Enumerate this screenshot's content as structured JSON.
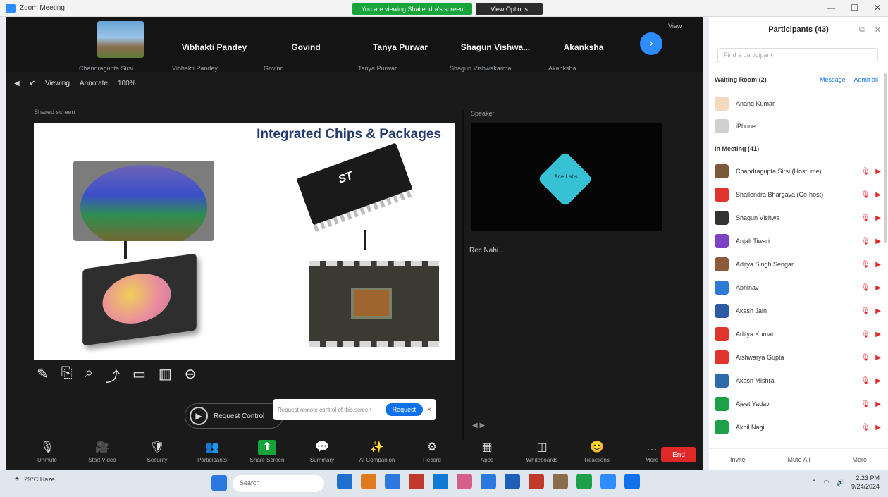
{
  "window": {
    "title": "Zoom Meeting",
    "share_banner": "You are viewing Shailendra's screen",
    "stop_button": "View Options"
  },
  "strip": {
    "participants": [
      {
        "name": "",
        "sub": "Chandragupta Sirsi"
      },
      {
        "name": "Vibhakti Pandey",
        "sub": "Vibhakti Pandey"
      },
      {
        "name": "Govind",
        "sub": "Govind"
      },
      {
        "name": "Tanya Purwar",
        "sub": "Tanya Purwar"
      },
      {
        "name": "Shagun Vishwa...",
        "sub": "Shagun Vishwakarma"
      },
      {
        "name": "Akanksha",
        "sub": "Akanksha"
      }
    ],
    "view_label": "View"
  },
  "subbar": {
    "viewing": "Viewing",
    "annotate": "Annotate",
    "zoom": "100%"
  },
  "slide": {
    "title": "Integrated Chips & Packages",
    "chip_logo": "ST"
  },
  "share_labels": {
    "left": "Shared screen",
    "right": "Speaker"
  },
  "speaker_tile": {
    "brand": "Ace Labs"
  },
  "chat": {
    "line": "Rec Nahi..."
  },
  "toolbar": {
    "items": [
      {
        "icon": "🎙",
        "label": "Unmute"
      },
      {
        "icon": "🎥",
        "label": "Start Video"
      },
      {
        "icon": "🛡",
        "label": "Security"
      },
      {
        "icon": "👥",
        "label": "Participants"
      },
      {
        "icon": "⬆",
        "label": "Share Screen"
      },
      {
        "icon": "💬",
        "label": "Summary"
      },
      {
        "icon": "✨",
        "label": "AI Companion"
      },
      {
        "icon": "⚙",
        "label": "Record"
      },
      {
        "icon": "▦",
        "label": "Apps"
      },
      {
        "icon": "◫",
        "label": "Whiteboards"
      },
      {
        "icon": "😊",
        "label": "Reactions"
      },
      {
        "icon": "…",
        "label": "More"
      }
    ],
    "end": "End"
  },
  "annotation": {
    "control_text": "Request Control",
    "popup_text": "Request remote control of this screen",
    "popup_button": "Request",
    "popup_close": "×"
  },
  "panel": {
    "title": "Participants (43)",
    "search_placeholder": "Find a participant",
    "waiting": "Waiting Room (2)",
    "message": "Message",
    "admit_all": "Admit all",
    "waiting_people": [
      {
        "name": "Anand Kumar",
        "color": "#f3d9bf"
      },
      {
        "name": "iPhone",
        "color": "#cfcfcf"
      }
    ],
    "in_meeting": "In Meeting (41)",
    "people": [
      {
        "name": "Chandragupta Sirsi (Host, me)",
        "color": "#7a5a3a"
      },
      {
        "name": "Shailendra Bhargava (Co-host)",
        "color": "#e0342c"
      },
      {
        "name": "Shagun Vishwa",
        "color": "#333333"
      },
      {
        "name": "Anjali Tiwari",
        "color": "#7b42c4"
      },
      {
        "name": "Aditya Singh Sengar",
        "color": "#8a5a3a"
      },
      {
        "name": "Abhinav",
        "color": "#2e7bd6"
      },
      {
        "name": "Akash Jain",
        "color": "#2e5aa6"
      },
      {
        "name": "Aditya Kumar",
        "color": "#e0342c"
      },
      {
        "name": "Aishwarya Gupta",
        "color": "#e0342c"
      },
      {
        "name": "Akash Mishra",
        "color": "#2e6aa6"
      },
      {
        "name": "Ajeet Yadav",
        "color": "#1ea04a"
      },
      {
        "name": "Akhil Nagi",
        "color": "#1ea04a"
      }
    ],
    "footer": [
      "Invite",
      "Mute All",
      "More"
    ]
  },
  "taskbar": {
    "weather": "29°C Haze",
    "search": "Search",
    "time": "2:23 PM",
    "date": "9/24/2024",
    "apps": [
      "#1f6fd1",
      "#e07a1f",
      "#2b79e0",
      "#c0392b",
      "#0f7ad6",
      "#d45f8b",
      "#2b79e0",
      "#1d5fb8",
      "#c0392b",
      "#8a6d4b",
      "#1ea04a",
      "#2d8cff",
      "#0e71eb"
    ]
  }
}
